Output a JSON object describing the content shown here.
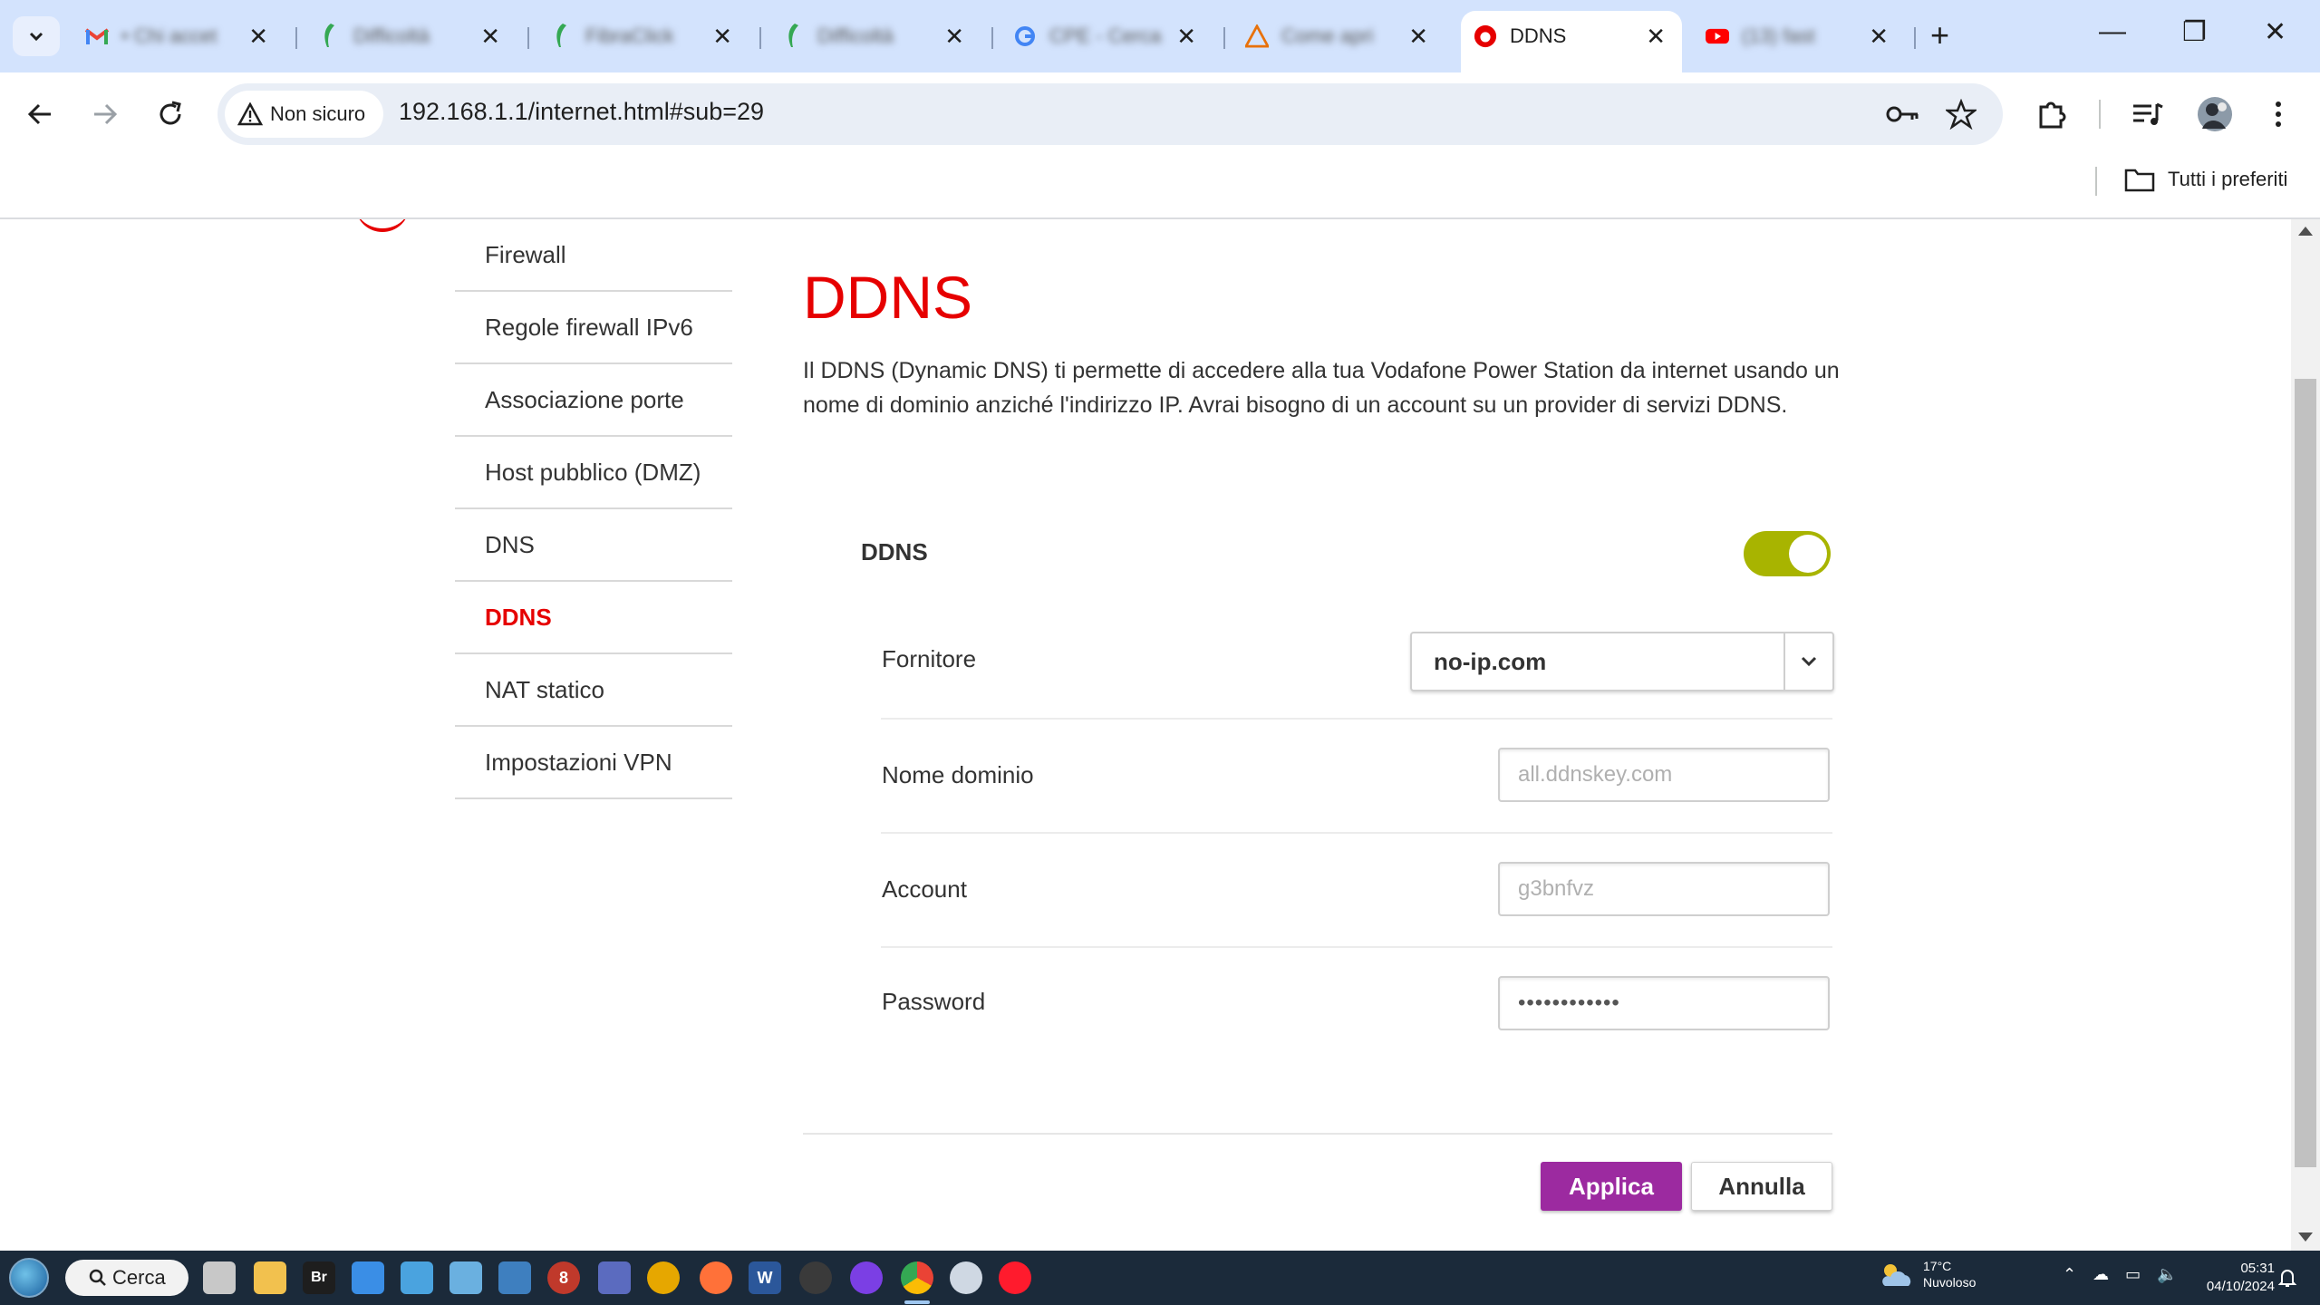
{
  "browser": {
    "tabs": [
      {
        "title": "• Chi accet",
        "favicon": "gmail-icon",
        "color": "#ea4335"
      },
      {
        "title": "Difficoltà",
        "favicon": "feather-icon",
        "color": "#34a853"
      },
      {
        "title": "FibraClick",
        "favicon": "feather-icon",
        "color": "#34a853"
      },
      {
        "title": "Difficoltà",
        "favicon": "feather-icon",
        "color": "#34a853"
      },
      {
        "title": "CPE - Cerca",
        "favicon": "google-icon",
        "color": "#4285f4"
      },
      {
        "title": "Come apri",
        "favicon": "warning-icon",
        "color": "#e8710a"
      },
      {
        "title": "DDNS",
        "favicon": "vodafone-icon",
        "color": "#e60000",
        "active": true
      },
      {
        "title": "(13) fast",
        "favicon": "youtube-icon",
        "color": "#ff0000"
      }
    ],
    "security_chip": "Non sicuro",
    "url": "192.168.1.1/internet.html#sub=29",
    "bookmarks_folder": "Tutti i preferiti"
  },
  "sidebar": {
    "items": [
      {
        "label": "Firewall"
      },
      {
        "label": "Regole firewall IPv6"
      },
      {
        "label": "Associazione porte"
      },
      {
        "label": "Host pubblico (DMZ)"
      },
      {
        "label": "DNS"
      },
      {
        "label": "DDNS",
        "active": true
      },
      {
        "label": "NAT statico"
      },
      {
        "label": "Impostazioni VPN"
      }
    ]
  },
  "main": {
    "title": "DDNS",
    "description": "Il DDNS (Dynamic DNS) ti permette di accedere alla tua Vodafone Power Station da internet usando un nome di dominio anziché l'indirizzo IP. Avrai bisogno di un account su un provider di servizi DDNS.",
    "ddns_toggle": {
      "label": "DDNS",
      "enabled": true
    },
    "provider": {
      "label": "Fornitore",
      "value": "no-ip.com"
    },
    "domain": {
      "label": "Nome dominio",
      "value": "all.ddnskey.com"
    },
    "account": {
      "label": "Account",
      "value": "g3bnfvz"
    },
    "password": {
      "label": "Password",
      "value": "••••••••••••"
    },
    "apply_label": "Applica",
    "cancel_label": "Annulla"
  },
  "taskbar": {
    "search_label": "Cerca",
    "weather": {
      "temp": "17°C",
      "condition": "Nuvoloso"
    },
    "time": "05:31",
    "date": "04/10/2024"
  },
  "colors": {
    "vodafone_red": "#e60000",
    "toggle_on": "#a8b400",
    "apply_button": "#9c2aa0"
  }
}
